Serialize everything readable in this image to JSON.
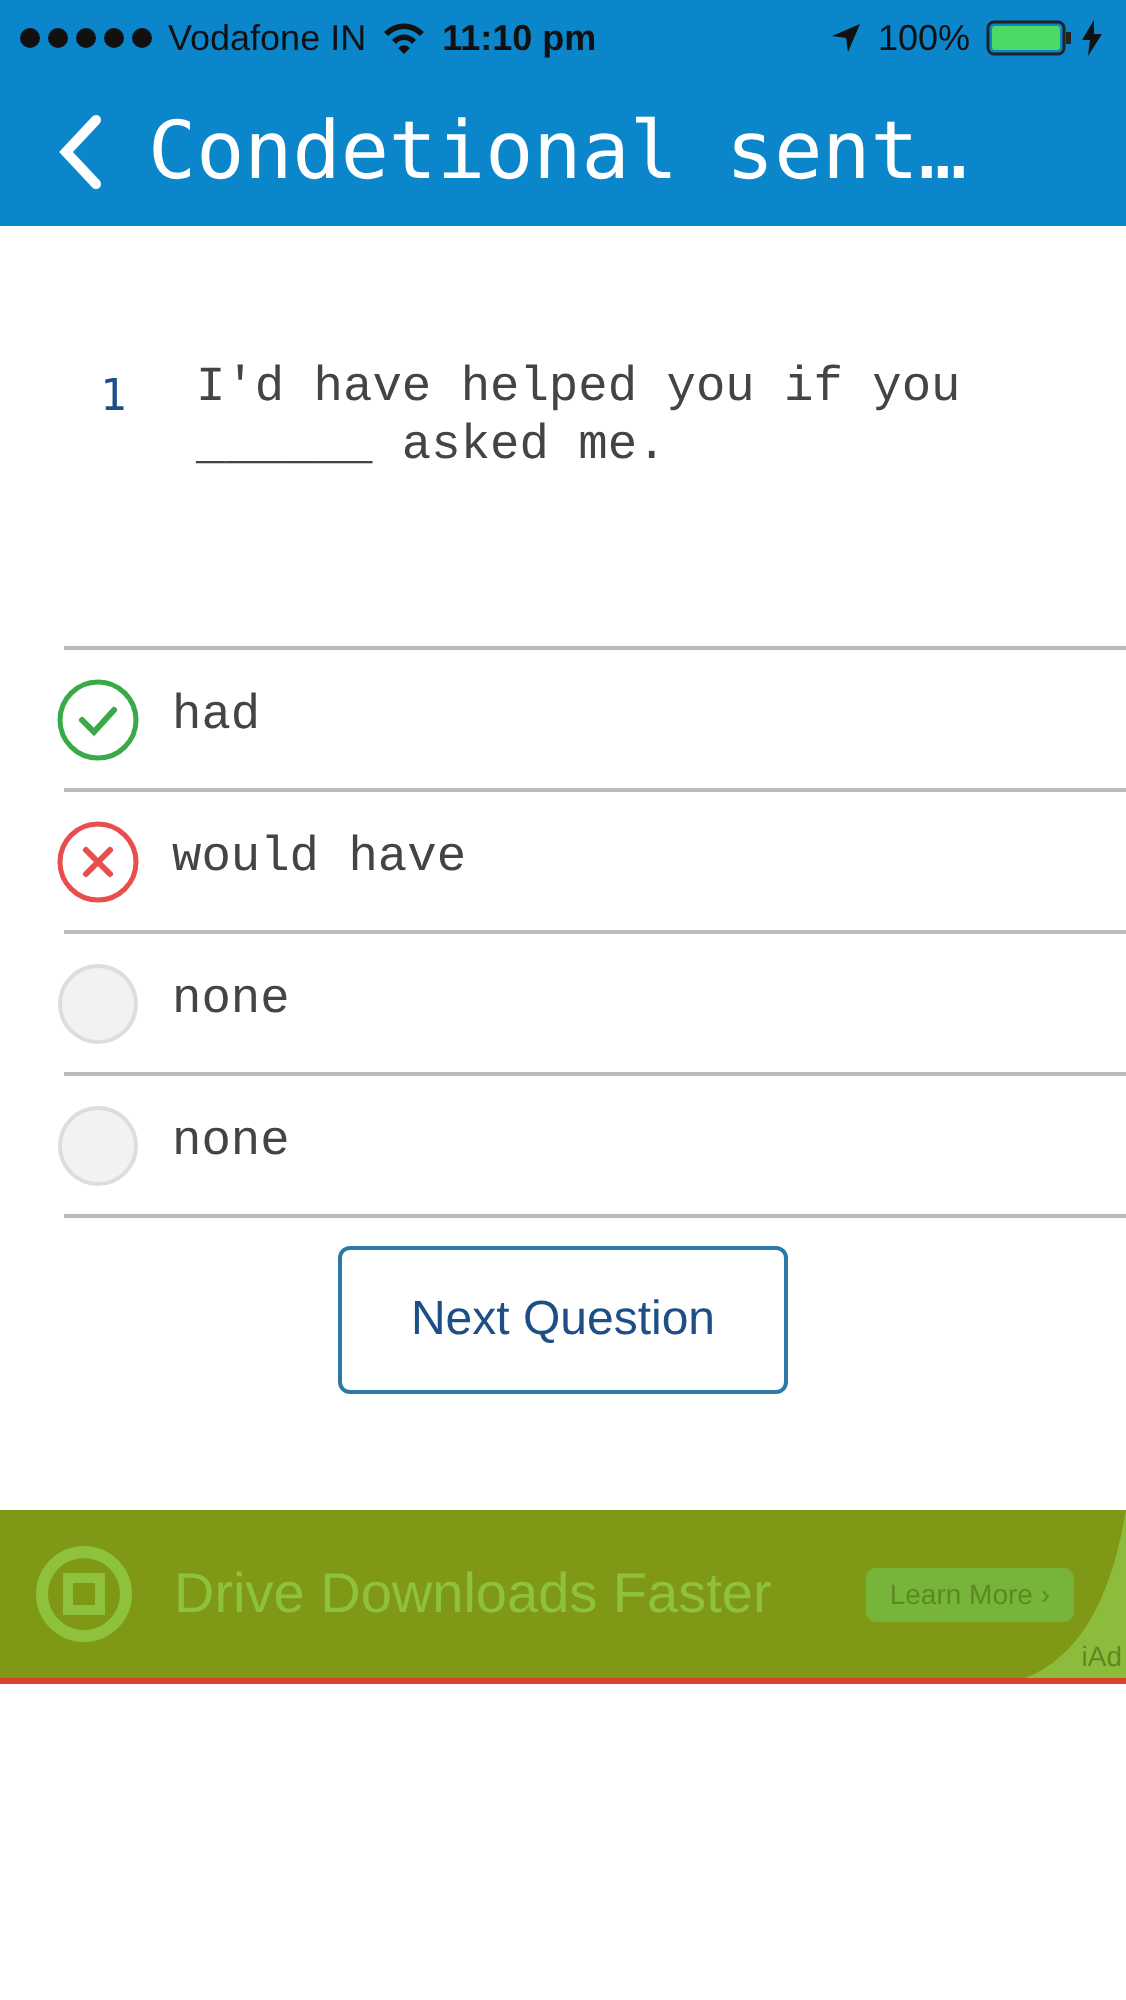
{
  "status_bar": {
    "carrier": "Vodafone IN",
    "time": "11:10 pm",
    "battery": "100%"
  },
  "header": {
    "title": "Condetional sent…"
  },
  "question": {
    "number": "1",
    "text": "I'd have helped you if you ______ asked me."
  },
  "options": [
    {
      "label": "had",
      "kind": "correct"
    },
    {
      "label": "would have",
      "kind": "wrong"
    },
    {
      "label": "none",
      "kind": "blank"
    },
    {
      "label": "none",
      "kind": "blank"
    }
  ],
  "next_button": "Next Question",
  "ad": {
    "headline": "Drive Downloads Faster",
    "button": "Learn More ›",
    "tag": "iAd"
  }
}
